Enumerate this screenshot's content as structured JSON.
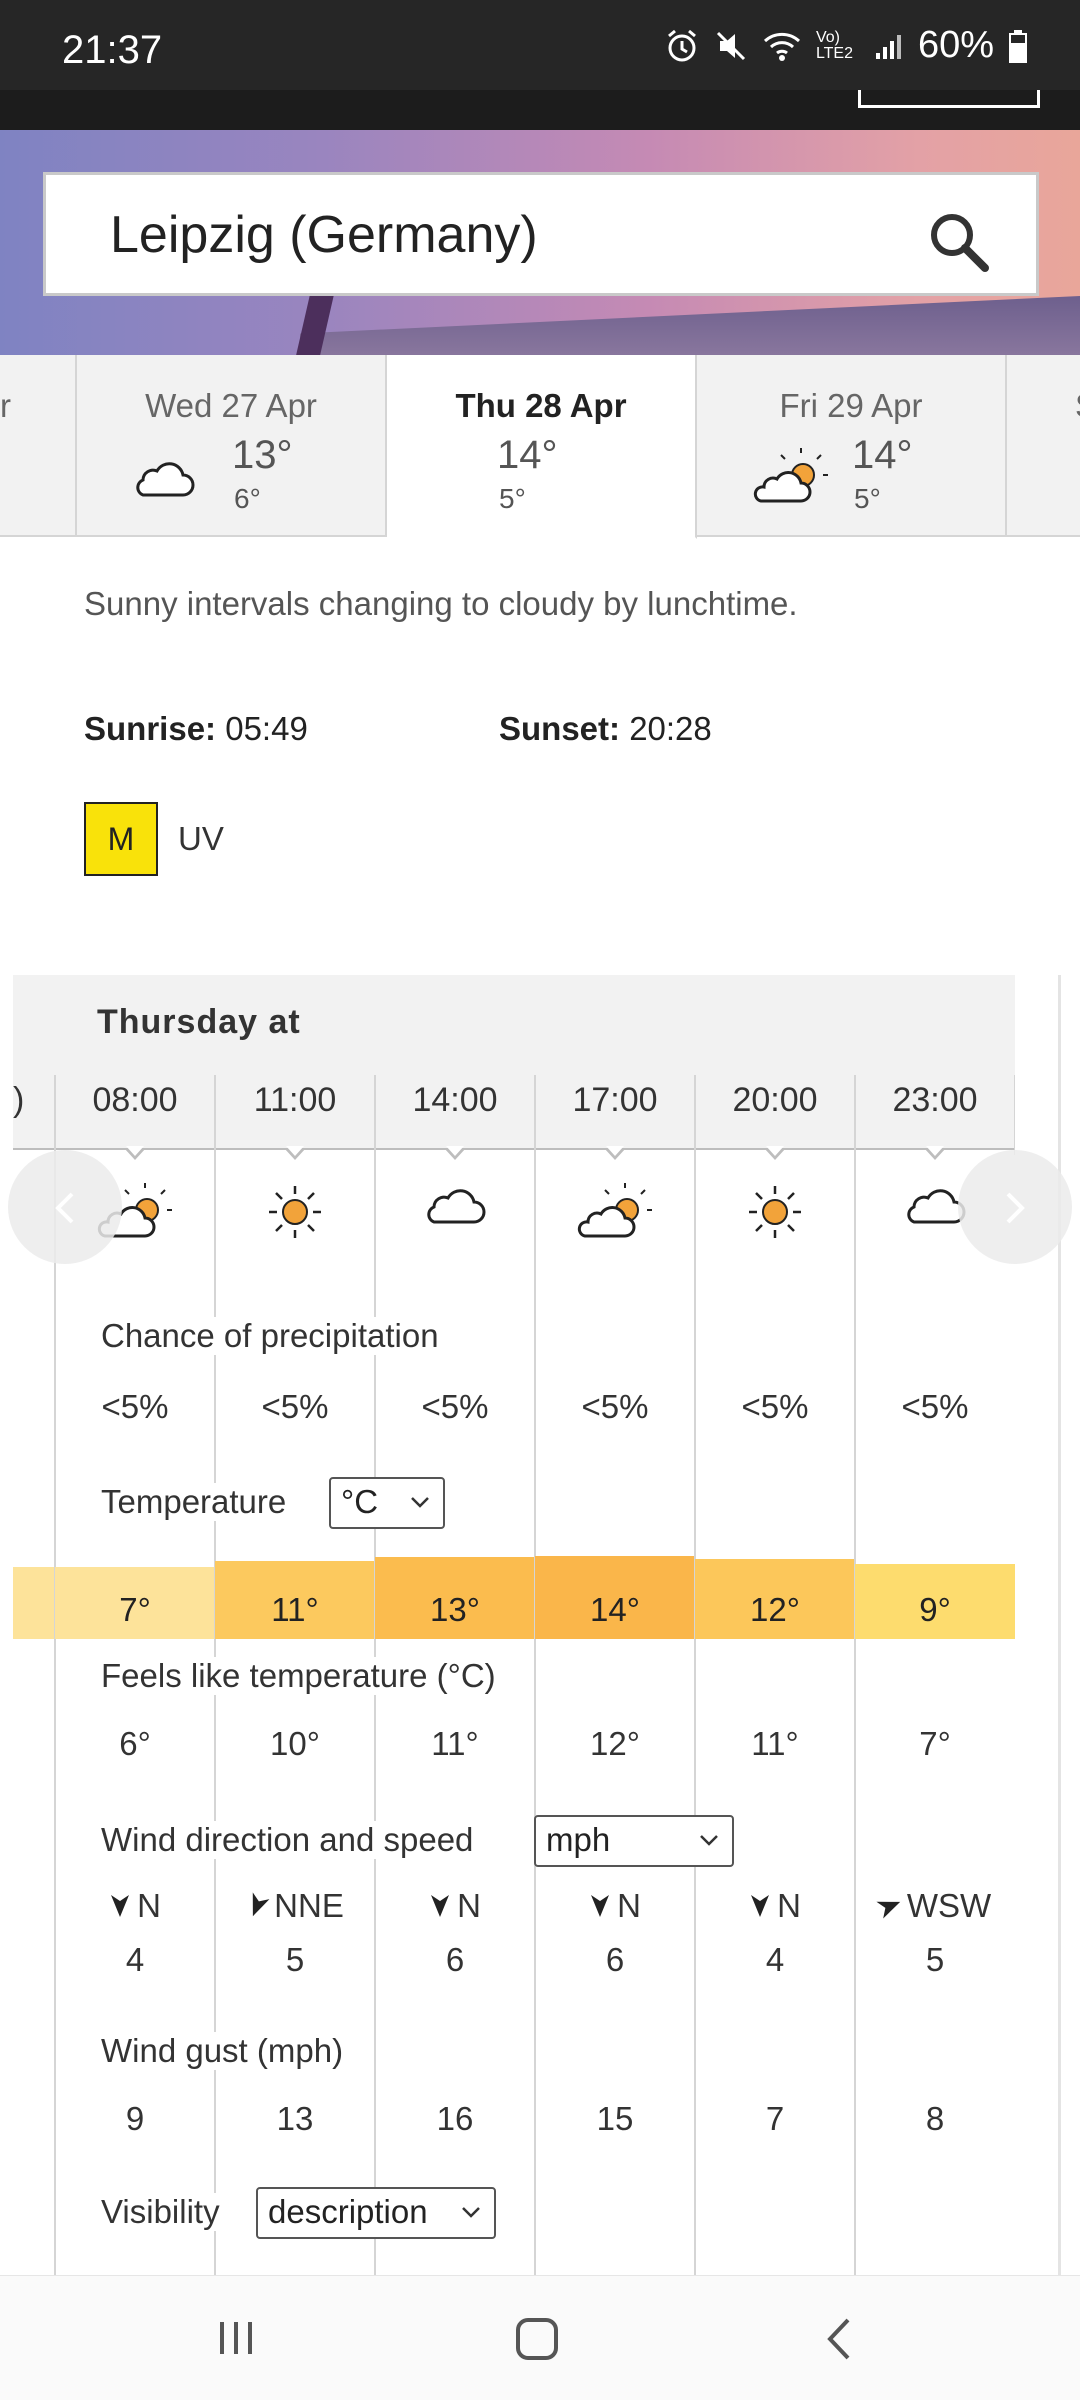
{
  "status_bar": {
    "time": "21:37",
    "battery": "60%",
    "network": "Vo) LTE2",
    "icons": [
      "alarm-icon",
      "mute-icon",
      "wifi-icon",
      "signal-icon",
      "battery-icon"
    ]
  },
  "search": {
    "value": "Leipzig (Germany)",
    "icon": "search-icon"
  },
  "day_tabs": [
    {
      "label": "r",
      "partial": true
    },
    {
      "label": "Wed 27 Apr",
      "high": "13°",
      "low": "6°",
      "icon": "cloud-icon"
    },
    {
      "label": "Thu 28 Apr",
      "high": "14°",
      "low": "5°",
      "selected": true
    },
    {
      "label": "Fri 29 Apr",
      "high": "14°",
      "low": "5°",
      "icon": "sunny-intervals-icon"
    },
    {
      "label": "S",
      "partial": true
    }
  ],
  "summary": "Sunny intervals changing to cloudy by lunchtime.",
  "sunrise": {
    "label": "Sunrise:",
    "value": "05:49"
  },
  "sunset": {
    "label": "Sunset:",
    "value": "20:28"
  },
  "uv": {
    "level": "M",
    "label": "UV",
    "color": "#f9e20a"
  },
  "hourly": {
    "title": "Thursday at",
    "partial_time": ")",
    "times": [
      "08:00",
      "11:00",
      "14:00",
      "17:00",
      "20:00",
      "23:00"
    ],
    "icons": [
      "sunny-intervals-icon",
      "sun-icon",
      "cloud-icon",
      "sunny-intervals-icon",
      "sun-icon",
      "cloud-icon"
    ],
    "precip_label": "Chance of precipitation",
    "precip": [
      "<5%",
      "<5%",
      "<5%",
      "<5%",
      "<5%",
      "<5%"
    ],
    "temp_label": "Temperature",
    "temp_unit": "°C",
    "temps": [
      "7°",
      "11°",
      "13°",
      "14°",
      "12°",
      "9°"
    ],
    "temp_values_c": [
      7,
      11,
      13,
      14,
      12,
      9
    ],
    "temp_colors": [
      "#fde39a",
      "#fcc95e",
      "#fbbc4e",
      "#fab64a",
      "#fcc75a",
      "#fddc6e"
    ],
    "feels_label": "Feels like temperature (°C)",
    "feels": [
      "6°",
      "10°",
      "11°",
      "12°",
      "11°",
      "7°"
    ],
    "wind_label": "Wind direction and speed",
    "wind_unit": "mph",
    "wind_dirs": [
      "N",
      "NNE",
      "N",
      "N",
      "N",
      "WSW"
    ],
    "wind_speeds": [
      "4",
      "5",
      "6",
      "6",
      "4",
      "5"
    ],
    "gust_label": "Wind gust (mph)",
    "gusts": [
      "9",
      "13",
      "16",
      "15",
      "7",
      "8"
    ],
    "visibility_label": "Visibility",
    "visibility_mode": "description"
  }
}
